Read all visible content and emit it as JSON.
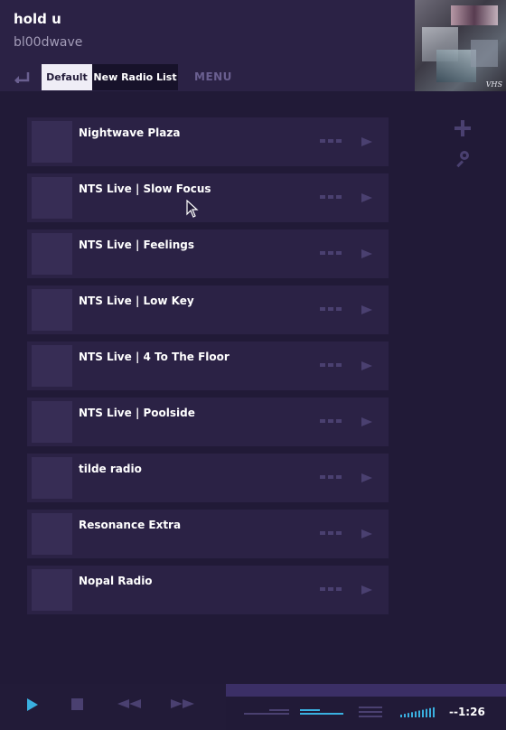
{
  "now_playing": {
    "title": "hold u",
    "artist": "bl00dwave"
  },
  "tabs": [
    {
      "label": "Default",
      "active": true
    },
    {
      "label": "New Radio List",
      "active": false
    }
  ],
  "menu_label": "MENU",
  "album_art": {
    "watermark": "VHS"
  },
  "stations": [
    {
      "name": "Nightwave Plaza"
    },
    {
      "name": "NTS Live | Slow Focus"
    },
    {
      "name": "NTS Live | Feelings"
    },
    {
      "name": "NTS Live | Low Key"
    },
    {
      "name": "NTS Live | 4 To The Floor"
    },
    {
      "name": "NTS Live | Poolside"
    },
    {
      "name": "tilde radio"
    },
    {
      "name": "Resonance Extra"
    },
    {
      "name": "Nopal Radio"
    }
  ],
  "player": {
    "time": "--1:26",
    "volume_level": 0.8
  },
  "icons": {
    "back": "back-arrow-icon",
    "add": "plus-icon",
    "search": "search-icon",
    "more": "more-dots-icon",
    "play": "play-icon",
    "stop": "stop-icon",
    "prev": "rewind-icon",
    "next": "fast-forward-icon"
  },
  "colors": {
    "background": "#211a37",
    "panel": "#2b2245",
    "accent": "#3ab0e0",
    "muted_icon": "#4a4070",
    "active_tab": "#efedf6"
  }
}
